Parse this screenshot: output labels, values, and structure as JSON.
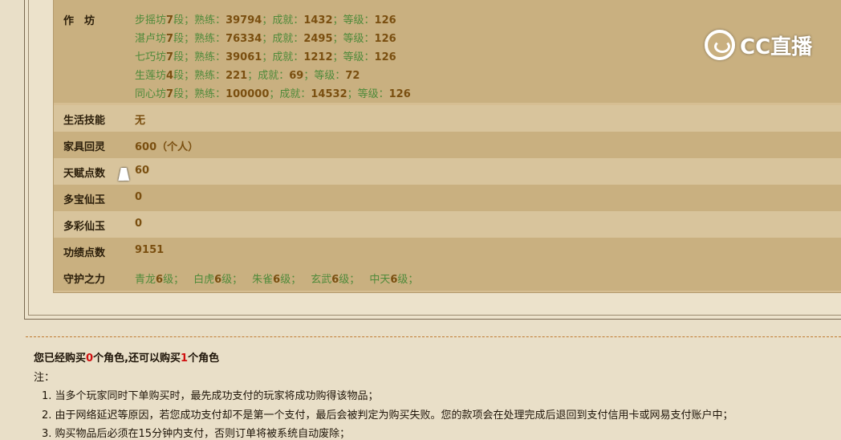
{
  "workshop": {
    "label": "作　坊",
    "lines": [
      {
        "name": "步摇坊",
        "seg": "7",
        "seg_unit": "段；",
        "prof_label": "熟练：",
        "prof": "39794",
        "ach_label": "；成就：",
        "ach": "1432",
        "lvl_label": "；等级：",
        "lvl": "126"
      },
      {
        "name": "湛卢坊",
        "seg": "7",
        "seg_unit": "段；",
        "prof_label": "熟练：",
        "prof": "76334",
        "ach_label": "；成就：",
        "ach": "2495",
        "lvl_label": "；等级：",
        "lvl": "126"
      },
      {
        "name": "七巧坊",
        "seg": "7",
        "seg_unit": "段；",
        "prof_label": "熟练：",
        "prof": "39061",
        "ach_label": "；成就：",
        "ach": "1212",
        "lvl_label": "；等级：",
        "lvl": "126"
      },
      {
        "name": "生莲坊",
        "seg": "4",
        "seg_unit": "段；",
        "prof_label": "熟练：",
        "prof": "221",
        "ach_label": "；成就：",
        "ach": "69",
        "lvl_label": "；等级：",
        "lvl": "72"
      },
      {
        "name": "同心坊",
        "seg": "7",
        "seg_unit": "段；",
        "prof_label": "熟练：",
        "prof": "100000",
        "ach_label": "；成就：",
        "ach": "14532",
        "lvl_label": "；等级：",
        "lvl": "126"
      }
    ]
  },
  "rows": [
    {
      "label": "生活技能",
      "value": "无"
    },
    {
      "label": "家具回灵",
      "value": "600（个人）"
    },
    {
      "label": "天赋点数",
      "value": "60"
    },
    {
      "label": "多宝仙玉",
      "value": "0"
    },
    {
      "label": "多彩仙玉",
      "value": "0"
    },
    {
      "label": "功绩点数",
      "value": "9151"
    }
  ],
  "guardian": {
    "label": "守护之力",
    "items": [
      {
        "name": "青龙",
        "lvl": "6",
        "unit": "级；"
      },
      {
        "name": "白虎",
        "lvl": "6",
        "unit": "级；"
      },
      {
        "name": "朱雀",
        "lvl": "6",
        "unit": "级；"
      },
      {
        "name": "玄武",
        "lvl": "6",
        "unit": "级；"
      },
      {
        "name": "中天",
        "lvl": "6",
        "unit": "级；"
      }
    ]
  },
  "notice": {
    "p1": "您已经购买",
    "bought": "0",
    "p2": "个角色,还可以购买",
    "remain": "1",
    "p3": "个角色"
  },
  "notes": {
    "head": "注：",
    "items": [
      "1. 当多个玩家同时下单购买时，最先成功支付的玩家将成功购得该物品；",
      "2. 由于网络延迟等原因，若您成功支付却不是第一个支付，最后会被判定为购买失败。您的款项会在处理完成后退回到支付信用卡或网易支付账户中；",
      "3. 购买物品后必须在15分钟内支付，否则订单将被系统自动废除；"
    ]
  },
  "watermark": {
    "text": "CC直播",
    "icon": "cc-live-logo-icon"
  },
  "colors": {
    "panel": "#d6be92",
    "green": "#4f8a3a",
    "brown": "#7a4f10",
    "red": "#d01010"
  }
}
